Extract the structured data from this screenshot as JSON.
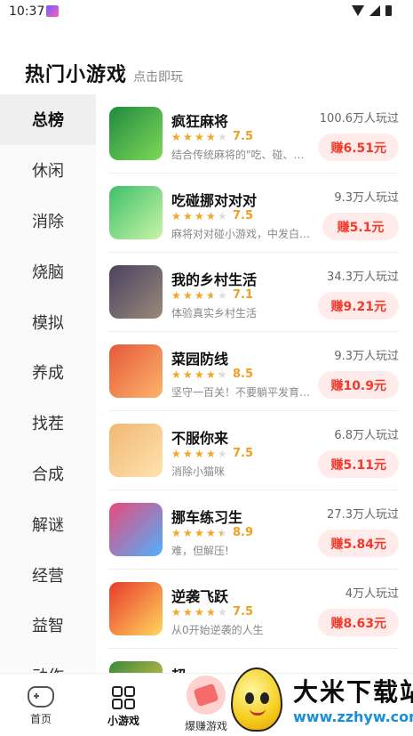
{
  "status_bar": {
    "time": "10:37"
  },
  "header": {
    "title": "热门小游戏",
    "subtitle": "点击即玩"
  },
  "sidebar": {
    "items": [
      {
        "label": "总榜",
        "active": true
      },
      {
        "label": "休闲"
      },
      {
        "label": "消除"
      },
      {
        "label": "烧脑"
      },
      {
        "label": "模拟"
      },
      {
        "label": "养成"
      },
      {
        "label": "找茬"
      },
      {
        "label": "合成"
      },
      {
        "label": "解谜"
      },
      {
        "label": "经营"
      },
      {
        "label": "益智"
      },
      {
        "label": "动作"
      }
    ]
  },
  "games": [
    {
      "name": "疯狂麻将",
      "rating": "7.5",
      "rating_value": 3.75,
      "desc": "结合传统麻将的\"吃、碰、…",
      "players": "100.6万人玩过",
      "reward": "赚6.51元",
      "icon": "mahjong-cow-icon",
      "icon_colors": [
        "#1f8a3f",
        "#7ed957"
      ]
    },
    {
      "name": "吃碰挪对对对",
      "rating": "7.5",
      "rating_value": 3.75,
      "desc": "麻将对对碰小游戏，中发白…",
      "players": "9.3万人玩过",
      "reward": "赚5.1元",
      "icon": "mahjong-pig-tile-icon",
      "icon_colors": [
        "#3fbf6a",
        "#c9f5a6"
      ]
    },
    {
      "name": "我的乡村生活",
      "rating": "7.1",
      "rating_value": 3.55,
      "desc": "体验真实乡村生活",
      "players": "34.3万人玩过",
      "reward": "赚9.21元",
      "icon": "village-elder-icon",
      "icon_colors": [
        "#4a4260",
        "#9a8a7a"
      ]
    },
    {
      "name": "菜园防线",
      "rating": "8.5",
      "rating_value": 4.25,
      "desc": "坚守一百关！不要躺平发育…",
      "players": "9.3万人玩过",
      "reward": "赚10.9元",
      "icon": "ninja-warrior-icon",
      "icon_colors": [
        "#e35a3a",
        "#ffb36b"
      ]
    },
    {
      "name": "不服你来",
      "rating": "7.5",
      "rating_value": 3.75,
      "desc": "消除小猫咪",
      "players": "6.8万人玩过",
      "reward": "赚5.11元",
      "icon": "orange-cat-icon",
      "icon_colors": [
        "#f0b872",
        "#ffe2b0"
      ]
    },
    {
      "name": "挪车练习生",
      "rating": "8.9",
      "rating_value": 4.45,
      "desc": "难，但解压!",
      "players": "27.3万人玩过",
      "reward": "赚5.84元",
      "icon": "traffic-jam-cars-icon",
      "icon_colors": [
        "#e94a7a",
        "#4fb0ff"
      ]
    },
    {
      "name": "逆袭飞跃",
      "rating": "7.5",
      "rating_value": 3.75,
      "desc": "从0开始逆袭的人生",
      "players": "4万人玩过",
      "reward": "赚8.63元",
      "icon": "red-sports-car-icon",
      "icon_colors": [
        "#e83a2a",
        "#ffd75e"
      ]
    },
    {
      "name": "超",
      "rating": "",
      "rating_value": 0,
      "desc": "",
      "players": "",
      "reward": "",
      "icon": "partial-game-icon",
      "icon_colors": [
        "#3a8a3a",
        "#f2c94c"
      ]
    }
  ],
  "bottom_nav": [
    {
      "label": "首页",
      "icon": "gamepad-icon"
    },
    {
      "label": "小游戏",
      "icon": "grid-icon",
      "active": true
    },
    {
      "label": "爆赚游戏",
      "icon": "red-envelope-icon"
    }
  ],
  "watermark": {
    "brand": "大米下载站",
    "url": "www.zzhyw.com"
  },
  "colors": {
    "accent": "#f2392b",
    "star": "#f5a623",
    "rating": "#f0a020",
    "button_bg": "#ffecea"
  }
}
